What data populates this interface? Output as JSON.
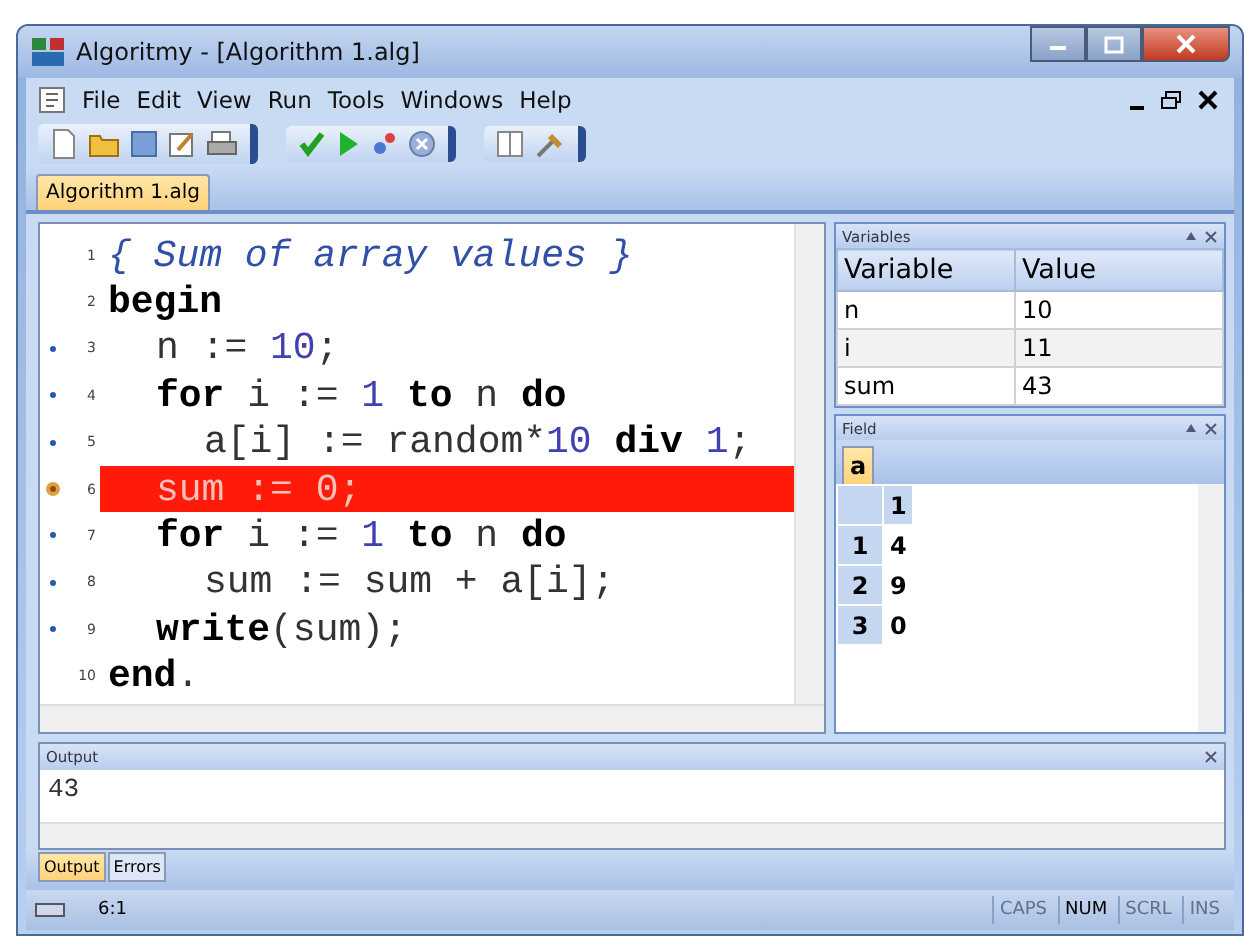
{
  "window": {
    "title": "Algoritmy - [Algorithm 1.alg]"
  },
  "menu": [
    "File",
    "Edit",
    "View",
    "Run",
    "Tools",
    "Windows",
    "Help"
  ],
  "document_tabs": [
    {
      "label": "Algorithm 1.alg",
      "selected": true
    }
  ],
  "editor": {
    "lines": [
      {
        "number": "1",
        "executable": false,
        "breakpoint": false,
        "tokens": [
          {
            "kind": "comment",
            "text": "{ Sum of array values }"
          }
        ]
      },
      {
        "number": "2",
        "executable": false,
        "breakpoint": false,
        "tokens": [
          {
            "kind": "keyword",
            "text": "begin"
          }
        ],
        "children": [
          {
            "number": "3",
            "executable": true,
            "breakpoint": false,
            "tokens": [
              {
                "kind": "plain",
                "text": "n := "
              },
              {
                "kind": "number",
                "text": "10"
              },
              {
                "kind": "plain",
                "text": ";"
              }
            ]
          },
          {
            "number": "4",
            "executable": true,
            "breakpoint": false,
            "tokens": [
              {
                "kind": "keyword",
                "text": "for"
              },
              {
                "kind": "plain",
                "text": " i := "
              },
              {
                "kind": "number",
                "text": "1"
              },
              {
                "kind": "keyword",
                "text": " to"
              },
              {
                "kind": "plain",
                "text": " n "
              },
              {
                "kind": "keyword",
                "text": "do"
              }
            ],
            "children": [
              {
                "number": "5",
                "executable": true,
                "breakpoint": false,
                "tokens": [
                  {
                    "kind": "plain",
                    "text": "a[i] := random*"
                  },
                  {
                    "kind": "number",
                    "text": "10"
                  },
                  {
                    "kind": "keyword",
                    "text": " div "
                  },
                  {
                    "kind": "number",
                    "text": "1"
                  },
                  {
                    "kind": "plain",
                    "text": ";"
                  }
                ]
              }
            ]
          },
          {
            "number": "6",
            "executable": true,
            "breakpoint": true,
            "tokens": [
              {
                "kind": "plain",
                "text": "sum := "
              },
              {
                "kind": "number",
                "text": "0"
              },
              {
                "kind": "plain",
                "text": ";"
              }
            ]
          },
          {
            "number": "7",
            "executable": true,
            "breakpoint": false,
            "tokens": [
              {
                "kind": "keyword",
                "text": "for"
              },
              {
                "kind": "plain",
                "text": " i := "
              },
              {
                "kind": "number",
                "text": "1"
              },
              {
                "kind": "keyword",
                "text": " to"
              },
              {
                "kind": "plain",
                "text": " n "
              },
              {
                "kind": "keyword",
                "text": "do"
              }
            ],
            "children": [
              {
                "number": "8",
                "executable": true,
                "breakpoint": false,
                "tokens": [
                  {
                    "kind": "plain",
                    "text": "sum := sum + a[i];"
                  }
                ]
              }
            ]
          },
          {
            "number": "9",
            "executable": true,
            "breakpoint": false,
            "tokens": [
              {
                "kind": "keyword",
                "text": "write"
              },
              {
                "kind": "plain",
                "text": "(sum);"
              }
            ]
          }
        ]
      },
      {
        "number": "10",
        "executable": false,
        "breakpoint": false,
        "tokens": [
          {
            "kind": "keyword",
            "text": "end"
          },
          {
            "kind": "plain",
            "text": "."
          }
        ]
      }
    ]
  },
  "variables_panel": {
    "title": "Variables",
    "columns": [
      "Variable",
      "Value"
    ],
    "rows": [
      {
        "variable": "n",
        "value": "10"
      },
      {
        "variable": "i",
        "value": "11"
      },
      {
        "variable": "sum",
        "value": "43"
      }
    ]
  },
  "field_panel": {
    "title": "Field",
    "tabs": [
      {
        "label": "a",
        "selected": true
      }
    ],
    "column_headers": [
      "1"
    ],
    "rows": [
      {
        "index": "1",
        "value": "4"
      },
      {
        "index": "2",
        "value": "9"
      },
      {
        "index": "3",
        "value": "0"
      }
    ]
  },
  "output_panel": {
    "title": "Output",
    "text": "43"
  },
  "output_tabs": [
    {
      "label": "Output",
      "selected": true
    },
    {
      "label": "Errors",
      "selected": false
    }
  ],
  "status_bar": {
    "position": "6:1",
    "indicators": [
      {
        "label": "CAPS",
        "disabled": true
      },
      {
        "label": "NUM",
        "disabled": false
      },
      {
        "label": "SCRL",
        "disabled": true
      },
      {
        "label": "INS",
        "disabled": true
      }
    ]
  }
}
